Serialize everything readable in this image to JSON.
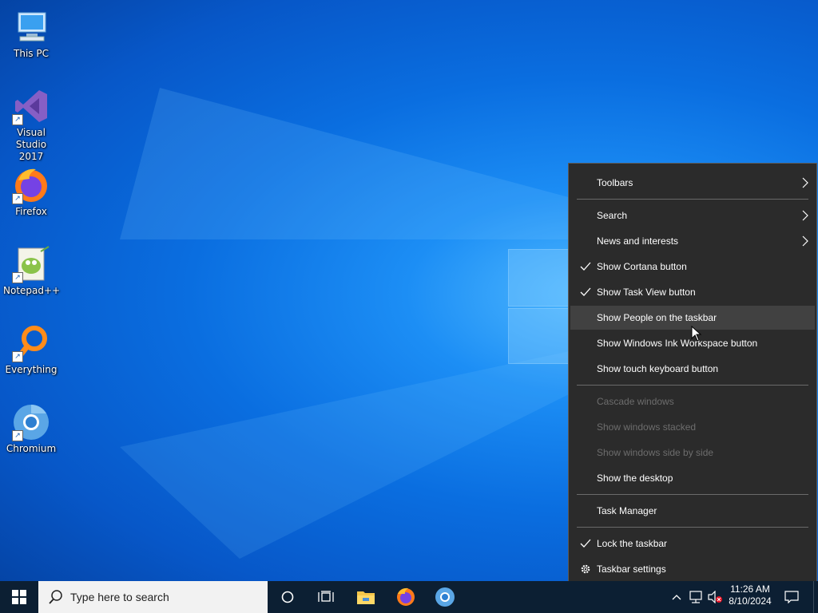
{
  "desktop": {
    "icons": [
      {
        "label": "This PC",
        "icon": "computer-icon"
      },
      {
        "label": "Visual Studio 2017",
        "icon": "visual-studio-icon"
      },
      {
        "label": "Firefox",
        "icon": "firefox-icon"
      },
      {
        "label": "Notepad++",
        "icon": "notepadpp-icon"
      },
      {
        "label": "Everything",
        "icon": "everything-icon"
      },
      {
        "label": "Chromium",
        "icon": "chromium-icon"
      }
    ]
  },
  "context_menu": {
    "items": [
      {
        "label": "Toolbars",
        "submenu": true,
        "checked": false,
        "enabled": true
      },
      {
        "label": "Search",
        "submenu": true,
        "checked": false,
        "enabled": true
      },
      {
        "label": "News and interests",
        "submenu": true,
        "checked": false,
        "enabled": true
      },
      {
        "label": "Show Cortana button",
        "submenu": false,
        "checked": true,
        "enabled": true
      },
      {
        "label": "Show Task View button",
        "submenu": false,
        "checked": true,
        "enabled": true
      },
      {
        "label": "Show People on the taskbar",
        "submenu": false,
        "checked": false,
        "enabled": true,
        "hovered": true
      },
      {
        "label": "Show Windows Ink Workspace button",
        "submenu": false,
        "checked": false,
        "enabled": true
      },
      {
        "label": "Show touch keyboard button",
        "submenu": false,
        "checked": false,
        "enabled": true
      },
      {
        "label": "Cascade windows",
        "submenu": false,
        "checked": false,
        "enabled": false
      },
      {
        "label": "Show windows stacked",
        "submenu": false,
        "checked": false,
        "enabled": false
      },
      {
        "label": "Show windows side by side",
        "submenu": false,
        "checked": false,
        "enabled": false
      },
      {
        "label": "Show the desktop",
        "submenu": false,
        "checked": false,
        "enabled": true
      },
      {
        "label": "Task Manager",
        "submenu": false,
        "checked": false,
        "enabled": true
      },
      {
        "label": "Lock the taskbar",
        "submenu": false,
        "checked": true,
        "enabled": true
      },
      {
        "label": "Taskbar settings",
        "submenu": false,
        "checked": false,
        "enabled": true,
        "icon": "gear-icon"
      }
    ]
  },
  "taskbar": {
    "search_placeholder": "Type here to search",
    "pinned": [
      "cortana-icon",
      "task-view-icon",
      "file-explorer-icon",
      "firefox-icon",
      "chromium-icon"
    ],
    "tray": [
      "chevron-up-icon",
      "network-icon",
      "volume-muted-icon",
      "notifications-icon"
    ],
    "clock_time": "11:26 AM",
    "clock_date": "8/10/2024"
  },
  "colors": {
    "taskbar": "#0c1f33",
    "menu_bg": "#2b2b2b",
    "menu_hover": "#414141",
    "menu_disabled_text": "#6d6d6d"
  }
}
